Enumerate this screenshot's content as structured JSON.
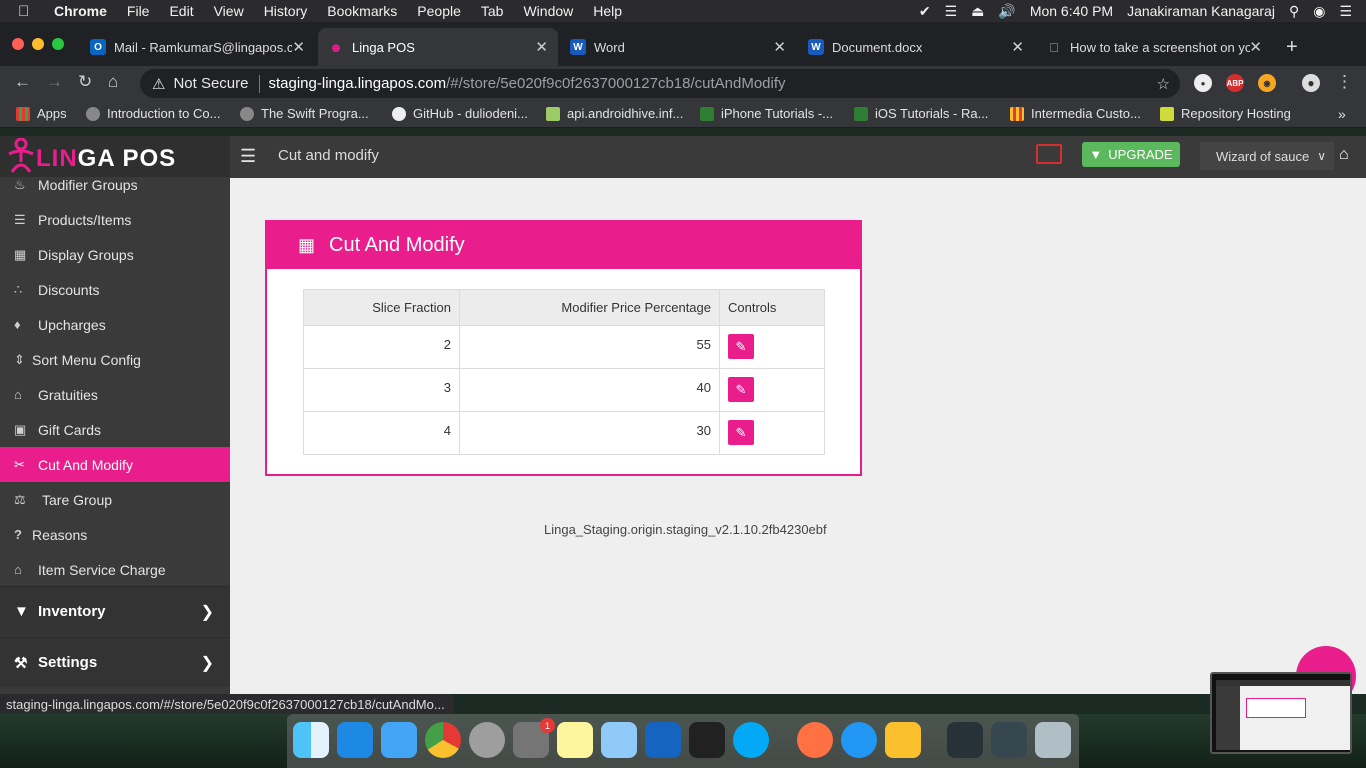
{
  "menubar": {
    "app": "Chrome",
    "items": [
      "File",
      "Edit",
      "View",
      "History",
      "Bookmarks",
      "People",
      "Tab",
      "Window",
      "Help"
    ],
    "clock": "Mon 6:40 PM",
    "user": "Janakiraman Kanagaraj"
  },
  "tabs": [
    {
      "title": "Mail - RamkumarS@lingapos.co",
      "icon": "outlook-icon"
    },
    {
      "title": "Linga POS",
      "icon": "linga-icon"
    },
    {
      "title": "Word",
      "icon": "word-icon"
    },
    {
      "title": "Document.docx",
      "icon": "word-icon"
    },
    {
      "title": "How to take a screenshot on yo",
      "icon": "apple-icon"
    }
  ],
  "address": {
    "security": "Not Secure",
    "host": "staging-linga.lingapos.com",
    "path": "/#/store/5e020f9c0f2637000127cb18/cutAndModify"
  },
  "bookmarks": [
    "Apps",
    "Introduction to Co...",
    "The Swift Progra...",
    "GitHub - duliodeni...",
    "api.androidhive.inf...",
    "iPhone Tutorials -...",
    "iOS Tutorials - Ra...",
    "Intermedia Custo...",
    "Repository Hosting"
  ],
  "logo": {
    "part1": "LIN",
    "part2": "GA POS"
  },
  "header": {
    "page_title": "Cut and modify",
    "upgrade_label": "UPGRADE",
    "store_name": "Wizard of sauce"
  },
  "sidebar": {
    "items": [
      {
        "label": "Modifier Groups",
        "icon": "modifier-groups-icon"
      },
      {
        "label": "Products/Items",
        "icon": "products-icon"
      },
      {
        "label": "Display Groups",
        "icon": "display-groups-icon"
      },
      {
        "label": "Discounts",
        "icon": "discounts-icon"
      },
      {
        "label": "Upcharges",
        "icon": "tag-icon"
      },
      {
        "label": "Sort Menu Config",
        "icon": "sort-icon"
      },
      {
        "label": "Gratuities",
        "icon": "gratuities-icon"
      },
      {
        "label": "Gift Cards",
        "icon": "gift-icon"
      },
      {
        "label": "Cut And Modify",
        "icon": "cut-icon"
      },
      {
        "label": "Tare Group",
        "icon": "scale-icon"
      },
      {
        "label": "Reasons",
        "icon": "question-icon"
      },
      {
        "label": "Item Service Charge",
        "icon": "service-charge-icon"
      }
    ],
    "groups": [
      {
        "label": "Inventory",
        "icon": "basket-icon"
      },
      {
        "label": "Settings",
        "icon": "wrench-icon"
      }
    ]
  },
  "panel": {
    "title": "Cut And Modify",
    "columns": [
      "Slice Fraction",
      "Modifier Price Percentage",
      "Controls"
    ],
    "rows": [
      {
        "slice_fraction": "2",
        "modifier_price_percentage": "55"
      },
      {
        "slice_fraction": "3",
        "modifier_price_percentage": "40"
      },
      {
        "slice_fraction": "4",
        "modifier_price_percentage": "30"
      }
    ]
  },
  "version": "Linga_Staging.origin.staging_v2.1.10.2fb4230ebf",
  "status_url": "staging-linga.lingapos.com/#/store/5e020f9c0f2637000127cb18/cutAndMo...",
  "dock_badge": "1",
  "colors": {
    "accent": "#e91e8c",
    "sidebar": "#3a3a3a",
    "upgrade": "#5cb85c"
  }
}
